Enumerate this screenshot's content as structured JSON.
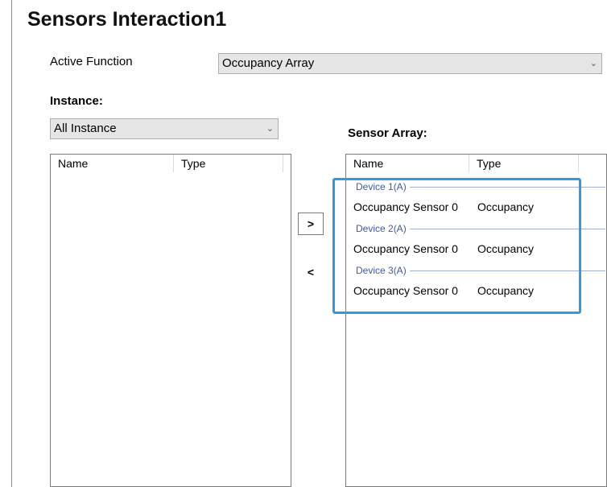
{
  "title": "Sensors Interaction1",
  "active_function": {
    "label": "Active Function",
    "selected": "Occupancy Array"
  },
  "instance": {
    "label": "Instance:",
    "selected": "All Instance",
    "columns": [
      "Name",
      "Type"
    ]
  },
  "sensor_array": {
    "label": "Sensor Array:",
    "columns": [
      "Name",
      "Type"
    ],
    "groups": [
      {
        "device": "Device 1(A)",
        "rows": [
          {
            "name": "Occupancy Sensor 0",
            "type": "Occupancy"
          }
        ]
      },
      {
        "device": "Device 2(A)",
        "rows": [
          {
            "name": "Occupancy Sensor 0",
            "type": "Occupancy"
          }
        ]
      },
      {
        "device": "Device 3(A)",
        "rows": [
          {
            "name": "Occupancy Sensor 0",
            "type": "Occupancy"
          }
        ]
      }
    ]
  },
  "buttons": {
    "add_label": ">",
    "remove_label": "<"
  },
  "icons": {
    "dropdown": "chevron-down-icon"
  },
  "colors": {
    "highlight": "#3399dd",
    "group_text": "#3f5aa6"
  }
}
